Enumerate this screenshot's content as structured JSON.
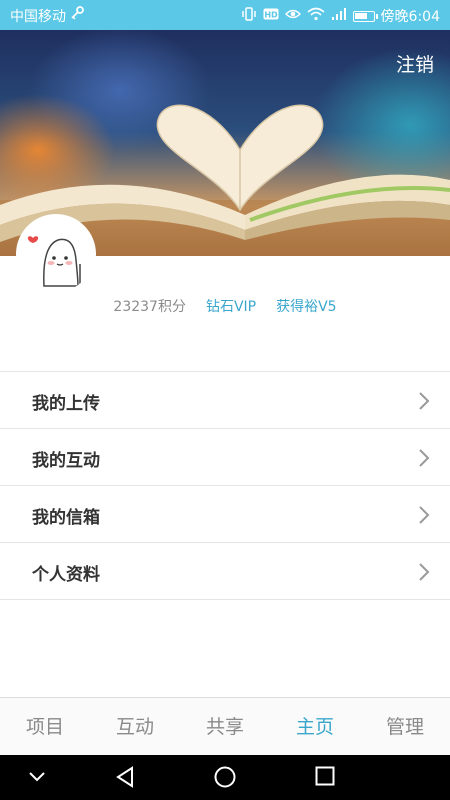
{
  "status_bar": {
    "carrier": "中国移动",
    "time": "傍晚6:04",
    "icons": [
      "key-icon",
      "vibrate-icon",
      "hd-icon",
      "eye-icon",
      "wifi-icon",
      "signal-icon",
      "battery-icon"
    ]
  },
  "header": {
    "logout_label": "注销",
    "banner_image": "open-book-heart-photo"
  },
  "profile": {
    "avatar": "cartoon-avatar",
    "points": "23237积分",
    "vip": "钻石VIP",
    "level": "获得裕V5"
  },
  "menu": {
    "items": [
      {
        "label": "我的上传"
      },
      {
        "label": "我的互动"
      },
      {
        "label": "我的信箱"
      },
      {
        "label": "个人资料"
      }
    ]
  },
  "tabbar": {
    "tabs": [
      {
        "label": "项目"
      },
      {
        "label": "互动"
      },
      {
        "label": "共享"
      },
      {
        "label": "主页"
      },
      {
        "label": "管理"
      }
    ],
    "active_tab": "主页"
  },
  "colors": {
    "status_bar": "#5ac8e6",
    "accent": "#3aa6cc",
    "text_dark": "#333333",
    "text_muted": "#8a8a8a"
  }
}
